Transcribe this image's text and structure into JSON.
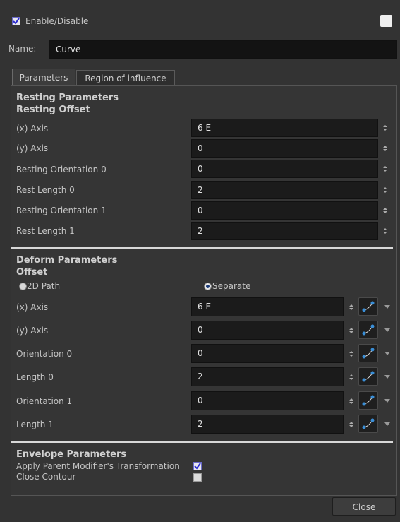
{
  "header": {
    "enable_label": "Enable/Disable",
    "enable_checked": true,
    "color_swatch": "#eeeeee"
  },
  "name_field": {
    "label": "Name:",
    "value": "Curve"
  },
  "tabs": [
    {
      "label": "Parameters",
      "active": true
    },
    {
      "label": "Region of influence",
      "active": false
    }
  ],
  "resting": {
    "section_title": "Resting Parameters",
    "offset_title": "Resting Offset",
    "rows": [
      {
        "label": "(x) Axis",
        "value": "6 E"
      },
      {
        "label": "(y) Axis",
        "value": "0"
      },
      {
        "label": "Resting Orientation 0",
        "value": "0"
      },
      {
        "label": "Rest Length 0",
        "value": "2"
      },
      {
        "label": "Resting Orientation 1",
        "value": "0"
      },
      {
        "label": "Rest Length 1",
        "value": "2"
      }
    ]
  },
  "deform": {
    "section_title": "Deform Parameters",
    "offset_title": "Offset",
    "mode_2d_label": "2D Path",
    "mode_separate_label": "Separate",
    "selected_mode": "Separate",
    "rows": [
      {
        "label": "(x) Axis",
        "value": "6 E"
      },
      {
        "label": "(y) Axis",
        "value": "0"
      },
      {
        "label": "Orientation 0",
        "value": "0"
      },
      {
        "label": "Length 0",
        "value": "2"
      },
      {
        "label": "Orientation 1",
        "value": "0"
      },
      {
        "label": "Length 1",
        "value": "2"
      }
    ]
  },
  "envelope": {
    "section_title": "Envelope Parameters",
    "apply_parent_label": "Apply Parent Modifier's Transformation",
    "apply_parent_checked": true,
    "close_contour_label": "Close Contour",
    "close_contour_checked": false
  },
  "footer": {
    "close_label": "Close"
  },
  "icons": {
    "spinner": "spinner-arrows-icon",
    "path_button": "function-curve-icon",
    "dropdown": "chevron-down-icon"
  },
  "colors": {
    "background": "#333333",
    "field": "#1b1b1b",
    "accent": "#3a8fd8"
  }
}
